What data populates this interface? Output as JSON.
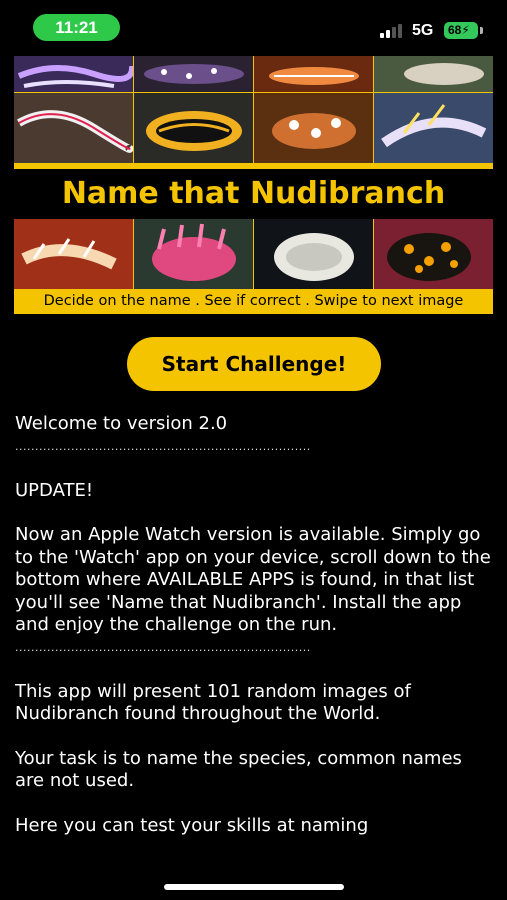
{
  "status_bar": {
    "time": "11:21",
    "network": "5G",
    "battery": "68",
    "battery_color": "#34c759"
  },
  "banner": {
    "title": "Name that Nudibranch",
    "tagline": "Decide on the name . See if correct . Swipe to next image",
    "accent_color": "#f5c400"
  },
  "start_button": {
    "label": "Start Challenge!"
  },
  "content": {
    "welcome": "Welcome to version 2.0",
    "divider": "..........................................................................",
    "update_heading": "UPDATE!",
    "update_text": "Now an Apple Watch version is available. Simply go to the 'Watch' app on your device, scroll down to the bottom where AVAILABLE APPS is found, in that list you'll see 'Name that Nudibranch'. Install the app and enjoy the challenge on the run.",
    "intro": "This app will present 101 random images of Nudibranch found throughout the World.",
    "task": "Your task is to name the species, common names are not used.",
    "skills": "Here you can test your skills at naming"
  }
}
